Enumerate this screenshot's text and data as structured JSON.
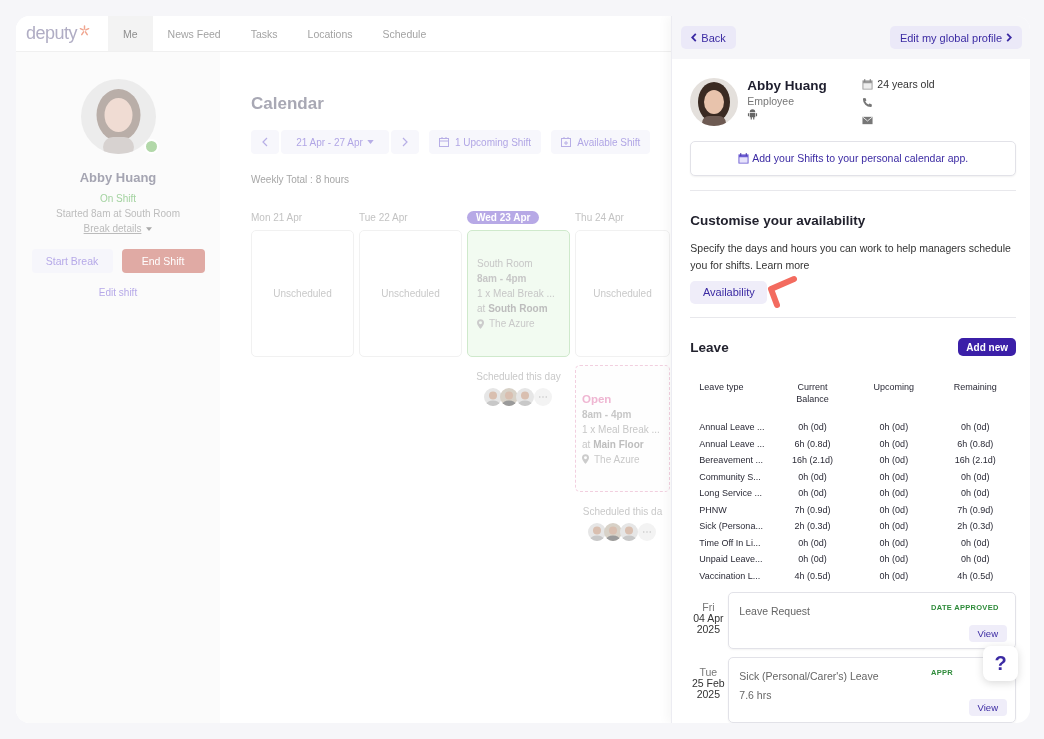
{
  "nav": {
    "logo": "deputy",
    "tabs": [
      {
        "label": "Me",
        "selected": true
      },
      {
        "label": "News Feed",
        "selected": false
      },
      {
        "label": "Tasks",
        "selected": false
      },
      {
        "label": "Locations",
        "selected": false
      },
      {
        "label": "Schedule",
        "selected": false
      }
    ]
  },
  "sidebar": {
    "name": "Abby Huang",
    "status": "On Shift",
    "started": "Started 8am at South Room",
    "break_details": "Break details",
    "buttons": [
      {
        "label": "Start Break",
        "kind": "secondary"
      },
      {
        "label": "End Shift",
        "kind": "danger"
      }
    ],
    "edit_link": "Edit shift"
  },
  "calendar": {
    "title": "Calendar",
    "range": "21 Apr - 27 Apr",
    "upcoming": "1 Upcoming Shift",
    "available": "Available Shift",
    "weekly_total": "Weekly Total : 8 hours",
    "days": [
      {
        "label": "Mon 21 Apr",
        "selected": false,
        "items": [
          {
            "kind": "unscheduled",
            "text": "Unscheduled"
          }
        ]
      },
      {
        "label": "Tue 22 Apr",
        "selected": false,
        "items": [
          {
            "kind": "unscheduled",
            "text": "Unscheduled"
          }
        ]
      },
      {
        "label": "Wed 23 Apr",
        "selected": true,
        "items": [
          {
            "kind": "shift",
            "title": "South Room",
            "time": "8am - 4pm",
            "break": "1 x Meal Break ...",
            "at": "at **South Room**",
            "site": "The Azure"
          },
          {
            "kind": "scheduled",
            "text": "Scheduled this day"
          }
        ]
      },
      {
        "label": "Thu 24 Apr",
        "selected": false,
        "items": [
          {
            "kind": "unscheduled",
            "text": "Unscheduled"
          },
          {
            "kind": "open",
            "title": "Open",
            "time": "8am - 4pm",
            "break": "1 x Meal Break ...",
            "at": "at **Main Floor**",
            "site": "The Azure"
          },
          {
            "kind": "scheduled",
            "text": "Scheduled this da"
          }
        ]
      }
    ]
  },
  "drawer": {
    "back": "Back",
    "edit_profile": "Edit my global profile",
    "profile": {
      "name": "Abby Huang",
      "role": "Employee",
      "age": "24 years old"
    },
    "calendar_link": "Add your Shifts to your personal calendar app.",
    "availability": {
      "title": "Customise your availability",
      "description": "Specify the days and hours you can work to help managers schedule you for shifts. Learn more",
      "button": "Availability"
    },
    "leave": {
      "title": "Leave",
      "add_button": "Add new",
      "columns": [
        "Leave type",
        "Current Balance",
        "Upcoming",
        "Remaining"
      ],
      "rows": [
        [
          "Annual Leave ...",
          "0h (0d)",
          "0h (0d)",
          "0h (0d)"
        ],
        [
          "Annual Leave ...",
          "6h (0.8d)",
          "0h (0d)",
          "6h (0.8d)"
        ],
        [
          "Bereavement ...",
          "16h (2.1d)",
          "0h (0d)",
          "16h (2.1d)"
        ],
        [
          "Community S...",
          "0h (0d)",
          "0h (0d)",
          "0h (0d)"
        ],
        [
          "Long Service ...",
          "0h (0d)",
          "0h (0d)",
          "0h (0d)"
        ],
        [
          "PHNW",
          "7h (0.9d)",
          "0h (0d)",
          "7h (0.9d)"
        ],
        [
          "Sick (Persona...",
          "2h (0.3d)",
          "0h (0d)",
          "2h (0.3d)"
        ],
        [
          "Time Off In Li...",
          "0h (0d)",
          "0h (0d)",
          "0h (0d)"
        ],
        [
          "Unpaid Leave...",
          "0h (0d)",
          "0h (0d)",
          "0h (0d)"
        ],
        [
          "Vaccination L...",
          "4h (0.5d)",
          "0h (0d)",
          "4h (0.5d)"
        ]
      ],
      "requests": [
        {
          "day": "Fri",
          "date": "04 Apr",
          "year": "2025",
          "title": "Leave Request",
          "status": "DATE APPROVED",
          "button": "View"
        },
        {
          "day": "Tue",
          "date": "25 Feb",
          "year": "2025",
          "title": "Sick (Personal/Carer's) Leave",
          "detail": "7.6 hrs",
          "status": "APPR",
          "button": "View"
        }
      ]
    }
  },
  "help": "?"
}
